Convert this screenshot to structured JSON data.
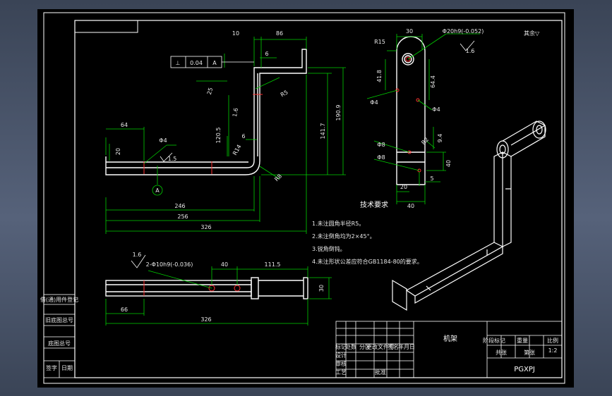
{
  "colors": {
    "background": "#000000",
    "frame": "#ffffff",
    "part": "#ffffff",
    "dimension": "#00ff00",
    "hidden_line": "#ff0000",
    "annotation": "#ffffff"
  },
  "drawing": {
    "title": "机架",
    "code": "PGXPJ",
    "scale": "1:2",
    "finish_note": "其余▽"
  },
  "tech_requirements": {
    "heading": "技术要求",
    "items": [
      "1.未注圆角半径R5。",
      "2.未注倒角均为2×45°。",
      "3.锐角倒钝。",
      "4.未注形状公差应符合GB1184-80的要求。"
    ]
  },
  "tolerance_frame": {
    "symbol": "⊥",
    "value": "0.04",
    "datum": "A"
  },
  "datum_label": "A",
  "front_view_dims": {
    "d10": "10",
    "d86": "86",
    "d6a": "6",
    "d25": "25",
    "d64": "64",
    "d6b": "6",
    "d20": "20",
    "dphi4a": "Φ4",
    "d15": "1.5",
    "d120": "120.5",
    "dr14": "R14",
    "dr8": "R8",
    "d141": "141.7",
    "d190": "190.9",
    "d246": "246",
    "d256": "256",
    "d326": "326",
    "r85": "R5",
    "d16": "1.6"
  },
  "side_view_dims": {
    "d30": "30",
    "phi30": "Φ20h9(-0.052)",
    "r15": "R15",
    "d16": "1.6",
    "d41": "41.8",
    "d64": "64.4",
    "phi4a": "Φ4",
    "phi4b": "Φ4",
    "phi8a": "Φ8",
    "phi8b": "Φ8",
    "r2": "R2",
    "d94": "9.4",
    "d40v": "40",
    "d20": "20",
    "d5": "5",
    "d40": "40"
  },
  "top_view_dims": {
    "d16": "1.6",
    "holes": "2-Φ10h9(-0.036)",
    "d40": "40",
    "d111": "111.5",
    "d30": "30",
    "d66": "66",
    "d326": "326"
  },
  "title_block_labels": [
    "标记",
    "处数",
    "分区",
    "更改文件号",
    "签名",
    "年月日",
    "设计",
    "审核",
    "工艺",
    "批准",
    "阶段标记",
    "重量",
    "比例",
    "共张",
    "第张"
  ],
  "left_strip_labels": [
    "借(通)用件登记",
    "旧底图总号",
    "底图总号",
    "签字",
    "日期"
  ]
}
